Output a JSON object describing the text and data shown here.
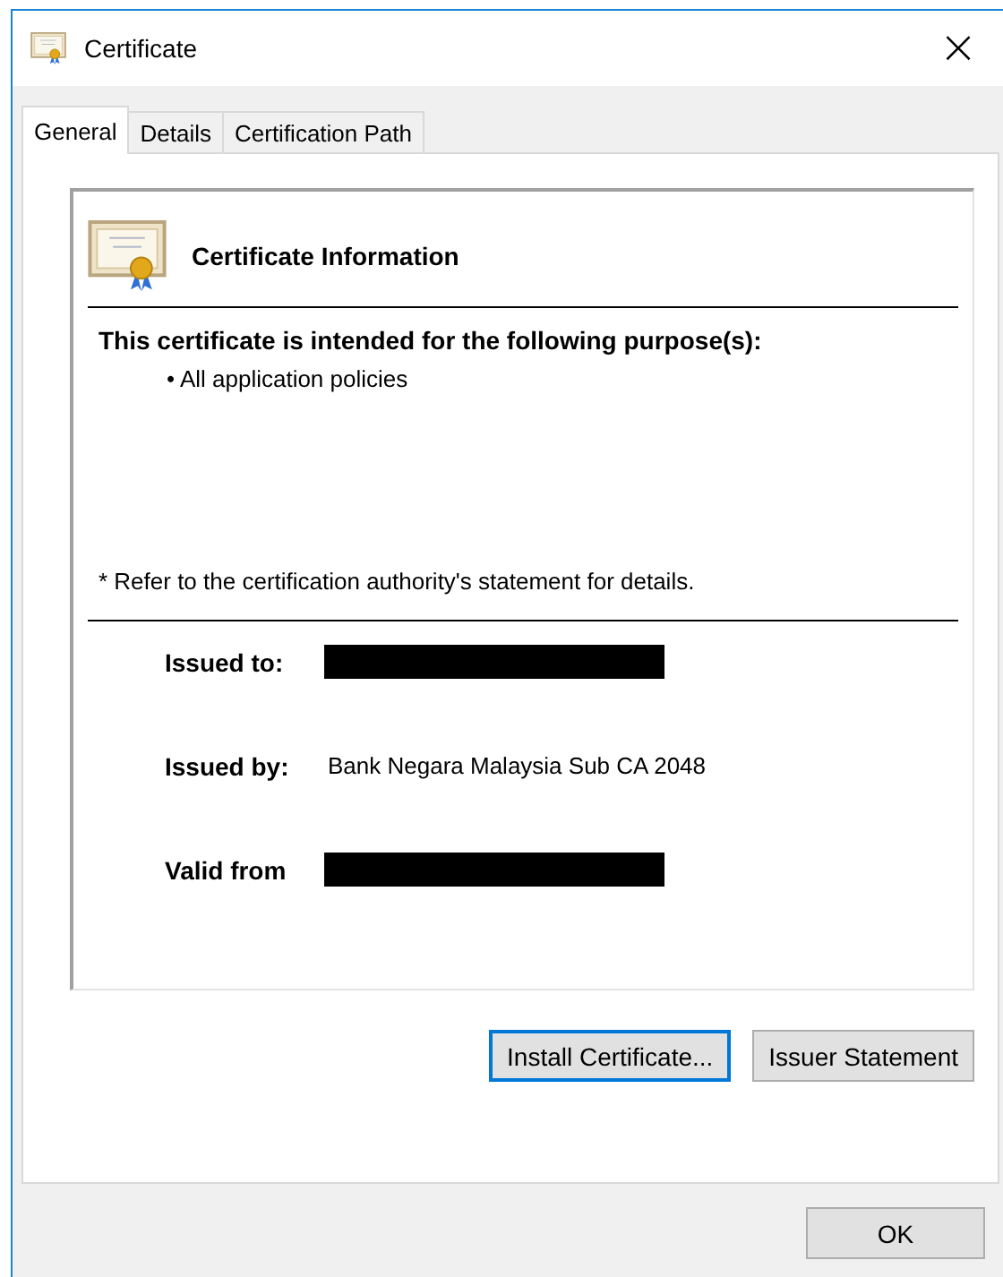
{
  "window": {
    "title": "Certificate",
    "close": "×"
  },
  "tabs": [
    {
      "label": "General",
      "selected": true
    },
    {
      "label": "Details",
      "selected": false
    },
    {
      "label": "Certification Path",
      "selected": false
    }
  ],
  "info": {
    "heading": "Certificate Information",
    "purpose_heading": "This certificate is intended for the following purpose(s):",
    "purposes": [
      "• All application policies"
    ],
    "footnote": "* Refer to the certification authority's statement for details."
  },
  "fields": [
    {
      "label": "Issued to:",
      "redacted": true
    },
    {
      "label": "Issued by:",
      "value": "Bank Negara Malaysia Sub CA 2048"
    },
    {
      "label": "Valid from",
      "redacted": true
    }
  ],
  "panel_buttons": [
    {
      "label": "Install Certificate...",
      "focused": true
    },
    {
      "label": "Issuer Statement",
      "focused": false
    }
  ],
  "footer_buttons": [
    {
      "label": "OK"
    }
  ]
}
